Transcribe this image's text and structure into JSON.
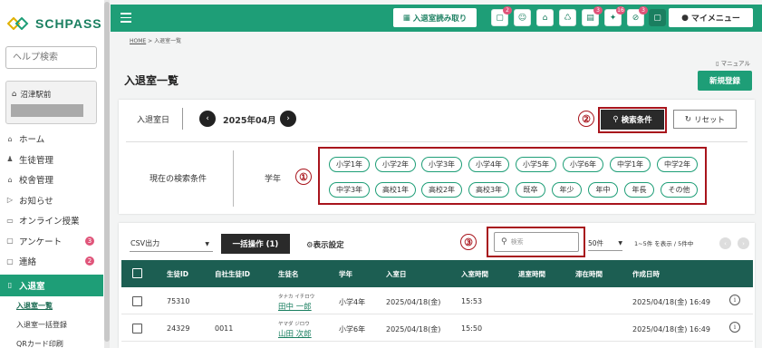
{
  "app": {
    "logo_text": "SCHPASS",
    "brand_color": "#1e9e77"
  },
  "sidebar": {
    "help_placeholder": "ヘルプ検索",
    "school_name": "沼津駅前",
    "items": [
      {
        "label": "ホーム",
        "icon": "home-icon"
      },
      {
        "label": "生徒管理",
        "icon": "person-icon"
      },
      {
        "label": "校舎管理",
        "icon": "building-icon"
      },
      {
        "label": "お知らせ",
        "icon": "send-icon"
      },
      {
        "label": "オンライン授業",
        "icon": "monitor-icon"
      },
      {
        "label": "アンケート",
        "icon": "chat-icon",
        "badge": "3"
      },
      {
        "label": "連絡",
        "icon": "message-icon",
        "badge": "2"
      },
      {
        "label": "入退室",
        "icon": "door-icon",
        "active": true
      }
    ],
    "subitems": [
      "入退室一覧",
      "入退室一括登録",
      "QRカード印刷"
    ]
  },
  "topbar": {
    "qr_button": "入退室読み取り",
    "icons": [
      {
        "name": "chat-icon",
        "badge": "2"
      },
      {
        "name": "group-icon",
        "badge": ""
      },
      {
        "name": "school-icon",
        "badge": ""
      },
      {
        "name": "trash-icon",
        "badge": ""
      },
      {
        "name": "document-icon",
        "badge": "3"
      },
      {
        "name": "star-icon",
        "badge": "16"
      },
      {
        "name": "prohibited-icon",
        "badge": "3"
      },
      {
        "name": "message-icon",
        "badge": ""
      }
    ],
    "mypage_label": "マイメニュー"
  },
  "breadcrumb": {
    "home": "HOME",
    "sep": ">",
    "current": "入退室一覧"
  },
  "manual_label": "マニュアル",
  "page_title": "入退室一覧",
  "new_button": "新規登録",
  "search": {
    "date_label": "入退室日",
    "date_value": "2025年04月",
    "search_button": "検索条件",
    "reset_button": "リセット",
    "condition_label": "現在の検索条件",
    "grade_label": "学年",
    "chips": [
      "小学1年",
      "小学2年",
      "小学3年",
      "小学4年",
      "小学5年",
      "小学6年",
      "中学1年",
      "中学2年",
      "中学3年",
      "高校1年",
      "高校2年",
      "高校3年",
      "既卒",
      "年少",
      "年中",
      "年長",
      "その他"
    ]
  },
  "annotations": [
    "①",
    "②",
    "③"
  ],
  "list": {
    "csv_label": "CSV出力",
    "bulk_button": "一括操作 (1)",
    "display_setting": "表示設定",
    "search_placeholder": "検索",
    "per_page": "50件",
    "range_text": "1~5件 を表示 / 5件中",
    "columns": [
      "生徒ID",
      "自社生徒ID",
      "生徒名",
      "学年",
      "入室日",
      "入室時間",
      "退室時間",
      "滞在時間",
      "作成日時"
    ],
    "rows": [
      {
        "student_id": "75310",
        "own_id": "",
        "kana": "タナカ イチロウ",
        "name": "田中 一郎",
        "grade": "小学4年",
        "entry_date": "2025/04/18(金)",
        "entry_time": "15:53",
        "exit_time": "",
        "stay": "",
        "created": "2025/04/18(金) 16:49"
      },
      {
        "student_id": "24329",
        "own_id": "0011",
        "kana": "ヤマダ ジロウ",
        "name": "山田 次郎",
        "grade": "小学6年",
        "entry_date": "2025/04/18(金)",
        "entry_time": "15:50",
        "exit_time": "",
        "stay": "",
        "created": "2025/04/18(金) 16:49"
      }
    ]
  }
}
